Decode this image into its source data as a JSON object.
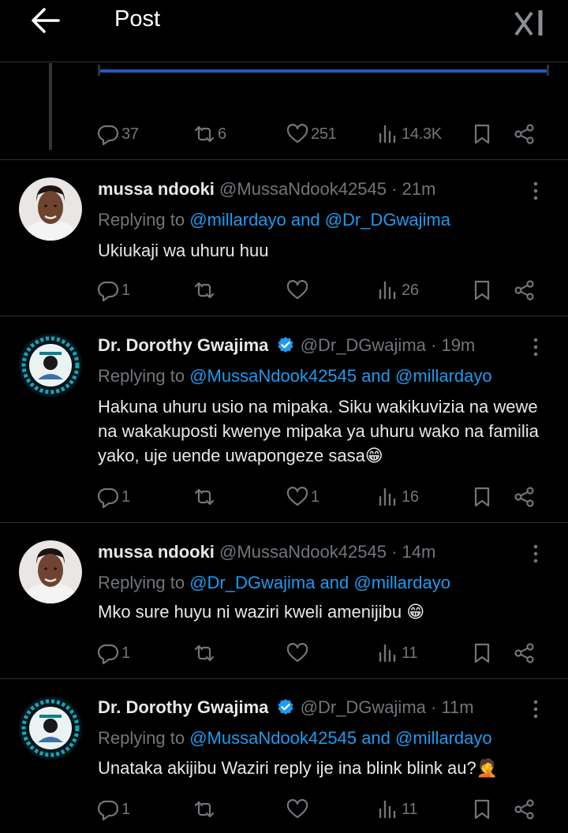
{
  "header": {
    "title": "Post",
    "back_icon": "arrow-left-icon",
    "logo_icon": "grok-logo-icon"
  },
  "colors": {
    "background": "#000000",
    "text": "#e7e9ea",
    "muted": "#71767b",
    "link": "#1d9bf0",
    "verified": "#1d9bf0",
    "divider": "#2f3336"
  },
  "main_post": {
    "actions": {
      "replies": "37",
      "reposts": "6",
      "likes": "251",
      "views": "14.3K"
    }
  },
  "replies": [
    {
      "name": "mussa ndooki",
      "verified": false,
      "handle": "@MussaNdook42545",
      "time": "· 21m",
      "replying_prefix": "Replying to ",
      "replying_to": "@millardayo and @Dr_DGwajima",
      "text": "Ukiukaji wa uhuru huu",
      "actions": {
        "replies": "1",
        "reposts": "",
        "likes": "",
        "views": "26"
      }
    },
    {
      "name": "Dr. Dorothy Gwajima",
      "verified": true,
      "handle": "@Dr_DGwajima",
      "time": "· 19m",
      "replying_prefix": "Replying to ",
      "replying_to": "@MussaNdook42545 and @millardayo",
      "text": "Hakuna uhuru usio na mipaka. Siku wakikuvizia na wewe na wakakuposti kwenye mipaka ya uhuru wako na familia yako, uje uende uwapongeze sasa😁",
      "actions": {
        "replies": "1",
        "reposts": "",
        "likes": "1",
        "views": "16"
      }
    },
    {
      "name": "mussa ndooki",
      "verified": false,
      "handle": "@MussaNdook42545",
      "time": "· 14m",
      "replying_prefix": "Replying to ",
      "replying_to": "@Dr_DGwajima and @millardayo",
      "text": "Mko sure huyu ni waziri kweli amenijibu 😁",
      "actions": {
        "replies": "1",
        "reposts": "",
        "likes": "",
        "views": "11"
      }
    },
    {
      "name": "Dr. Dorothy Gwajima",
      "verified": true,
      "handle": "@Dr_DGwajima",
      "time": "· 11m",
      "replying_prefix": "Replying to ",
      "replying_to": "@MussaNdook42545 and @millardayo",
      "text": "Unataka akijibu Waziri reply ije ina blink blink au?🤦",
      "actions": {
        "replies": "1",
        "reposts": "",
        "likes": "",
        "views": "11"
      }
    }
  ]
}
